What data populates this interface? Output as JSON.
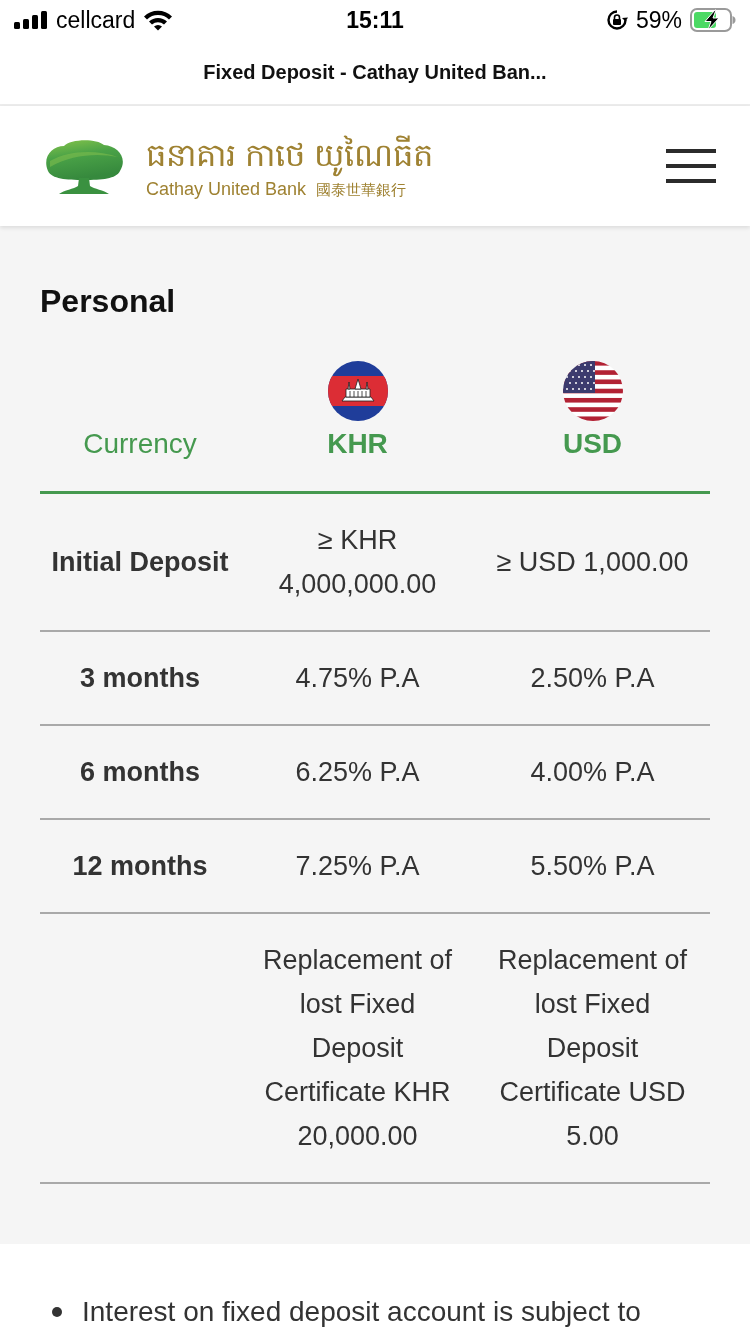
{
  "status_bar": {
    "carrier": "cellcard",
    "time": "15:11",
    "battery": "59%"
  },
  "browser": {
    "title": "Fixed Deposit - Cathay United Ban..."
  },
  "header": {
    "logo_khmer": "ធនាគារ កាថេ យូណៃធីត",
    "logo_english": "Cathay United Bank",
    "logo_chinese": "國泰世華銀行"
  },
  "section": {
    "title": "Personal"
  },
  "table": {
    "label_header": "Currency",
    "currencies": [
      {
        "code": "KHR"
      },
      {
        "code": "USD"
      }
    ],
    "rows": [
      {
        "label": "Initial Deposit",
        "values": [
          "≥ KHR 4,000,000.00",
          "≥ USD 1,000.00"
        ]
      },
      {
        "label": "3 months",
        "values": [
          "4.75% P.A",
          "2.50% P.A"
        ]
      },
      {
        "label": "6 months",
        "values": [
          "6.25% P.A",
          "4.00% P.A"
        ]
      },
      {
        "label": "12 months",
        "values": [
          "7.25% P.A",
          "5.50% P.A"
        ]
      },
      {
        "values": [
          "Replacement of lost Fixed Deposit Certificate KHR 20,000.00",
          "Replacement of lost Fixed Deposit Certificate USD 5.00"
        ]
      }
    ]
  },
  "notes": [
    "Interest on fixed deposit account is subject to"
  ]
}
